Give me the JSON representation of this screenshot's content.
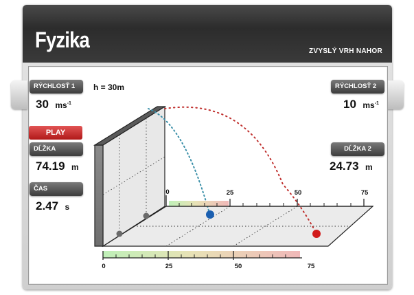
{
  "header": {
    "title": "Fyzika",
    "subtitle": "ZVYSLÝ VRH NAHOR"
  },
  "left": {
    "speed1_label": "RÝCHLOSŤ 1",
    "speed1_value": "30",
    "speed1_unit": "ms",
    "speed1_unit_exp": "-1",
    "play_label": "PLAY",
    "length_label": "DĹŽKA",
    "length_value": "74.19",
    "length_unit": "m",
    "time_label": "ČAS",
    "time_value": "2.47",
    "time_unit": "s"
  },
  "right": {
    "speed2_label": "RÝCHLOSŤ 2",
    "speed2_value": "10",
    "speed2_unit": "ms",
    "speed2_unit_exp": "-1",
    "length2_label": "DĹŽKA  2",
    "length2_value": "24.73",
    "length2_unit": "m"
  },
  "scene": {
    "height_label": "h = 30m",
    "back_ruler_ticks": [
      "0",
      "25",
      "50",
      "75"
    ],
    "front_ruler_ticks": [
      "0",
      "25",
      "50",
      "75"
    ],
    "ball1_color": "#d11a1a",
    "ball2_color": "#1b5fb0",
    "trajectory1_color": "#c0302e",
    "trajectory2_color": "#3a8fa8"
  }
}
